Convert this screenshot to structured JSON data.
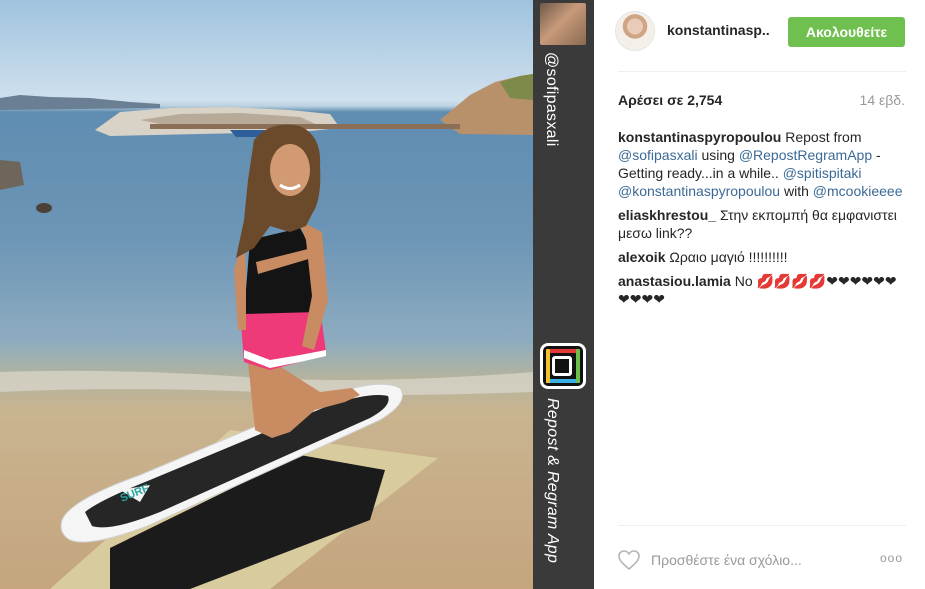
{
  "repost_strip": {
    "source_user": "@sofipasxali",
    "app_label": "Repost & Regram App"
  },
  "post": {
    "username": "konstantinasp..",
    "follow_label": "Ακολουθείτε",
    "likes_text": "Αρέσει σε 2,754",
    "time_text": "14 εβδ.",
    "caption": {
      "user": "konstantinaspyropoulou",
      "text_before": "Repost from",
      "mention_source": "@sofipasxali",
      "text_using": "using",
      "mention_app": "@RepostRegramApp",
      "text_middle": "- Getting ready...in a while..",
      "mention_3": "@spitispitaki",
      "mention_4": "@konstantinaspyropoulou",
      "text_with": "with",
      "mention_5": "@mcookieeee"
    },
    "comments": [
      {
        "user": "eliaskhrestou_",
        "text": "Στην εκπομπή θα εμφανιστει μεσω link??"
      },
      {
        "user": "alexoik",
        "text": "Ωραιο μαγιό !!!!!!!!!!"
      },
      {
        "user": "anastasiou.lamia",
        "text": "No 💋💋💋💋❤❤❤❤❤❤❤❤❤❤"
      }
    ],
    "add_comment_placeholder": "Προσθέστε ένα σχόλιο...",
    "more_label": "ooo"
  },
  "colors": {
    "follow_green": "#70c050",
    "mention_blue": "#3b6a96",
    "strip_dark": "#3a3a3a"
  },
  "icons": [
    "heart-icon",
    "more-options-icon",
    "repost-regram-logo-icon"
  ]
}
